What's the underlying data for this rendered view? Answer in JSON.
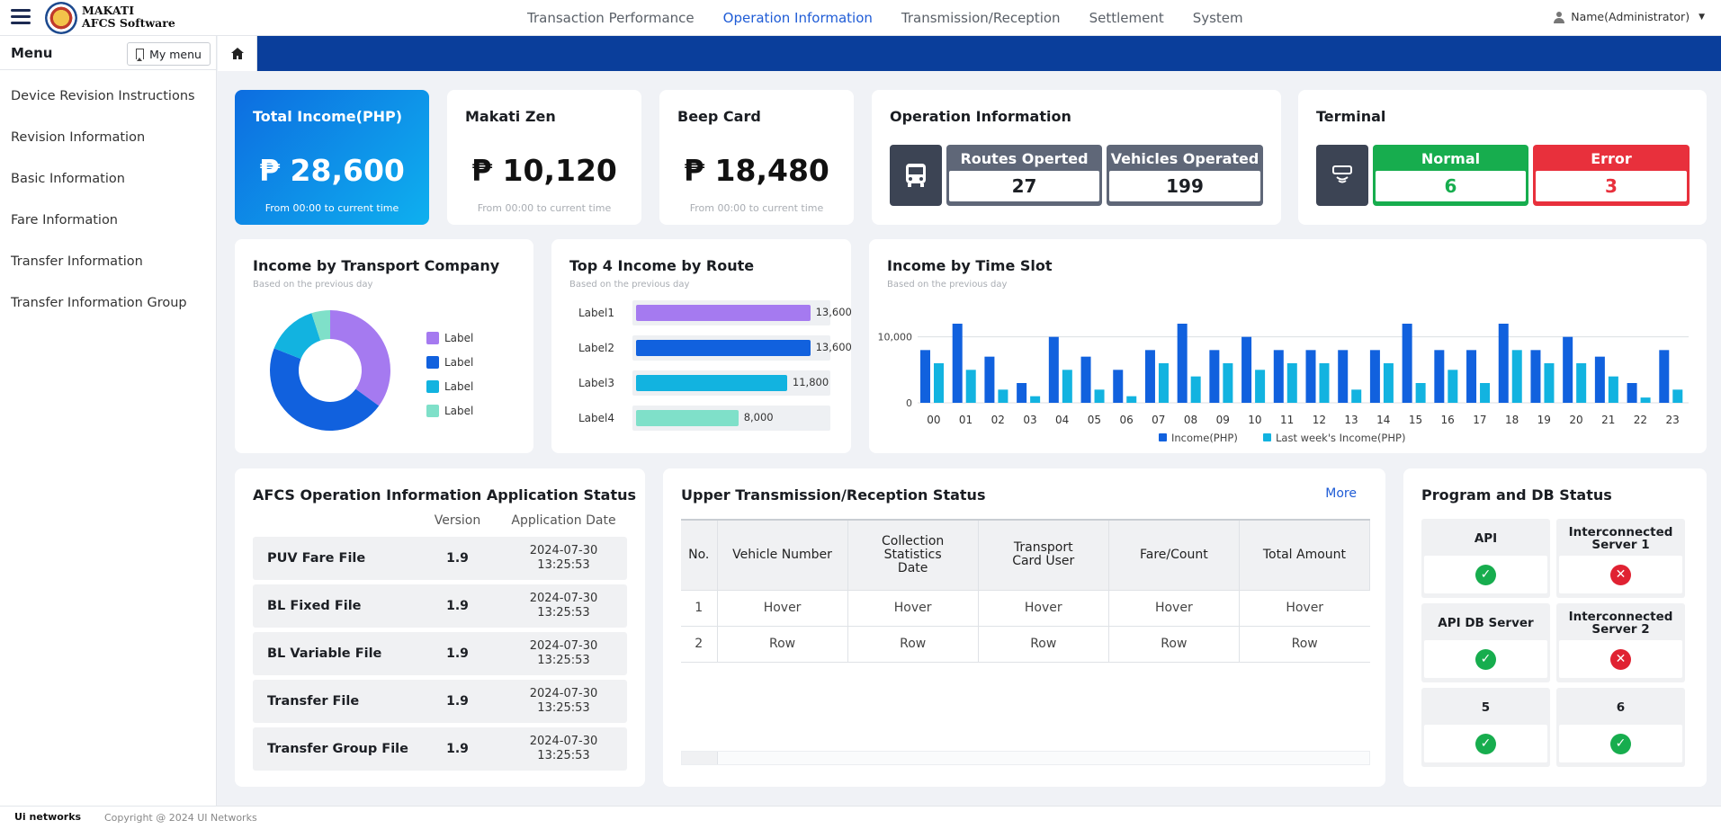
{
  "brand": {
    "line1": "MAKATI",
    "line2": "AFCS Software"
  },
  "topnav": [
    {
      "label": "Transaction Performance",
      "active": false
    },
    {
      "label": "Operation Information",
      "active": true
    },
    {
      "label": "Transmission/Reception",
      "active": false
    },
    {
      "label": "Settlement",
      "active": false
    },
    {
      "label": "System",
      "active": false
    }
  ],
  "user": {
    "name": "Name(Administrator)"
  },
  "sidebar": {
    "title": "Menu",
    "my_menu": "My menu",
    "items": [
      "Device Revision Instructions",
      "Revision Information",
      "Basic Information",
      "Fare Information",
      "Transfer Information",
      "Transfer Information Group"
    ]
  },
  "kpis": [
    {
      "title": "Total Income(PHP)",
      "value": "₱ 28,600",
      "note": "From 00:00 to current time"
    },
    {
      "title": "Makati Zen",
      "value": "₱ 10,120",
      "note": "From 00:00 to current time"
    },
    {
      "title": "Beep Card",
      "value": "₱ 18,480",
      "note": "From 00:00 to current time"
    }
  ],
  "operation": {
    "title": "Operation Information",
    "routes_label": "Routes Operted",
    "routes_value": "27",
    "vehicles_label": "Vehicles Operated",
    "vehicles_value": "199"
  },
  "terminal": {
    "title": "Terminal",
    "normal_label": "Normal",
    "normal_value": "6",
    "error_label": "Error",
    "error_value": "3"
  },
  "colors": {
    "accent": "#1f5cd6",
    "nav_bar": "#0a3e9b",
    "normal": "#17ad4e",
    "error": "#e8303c",
    "icon_box": "#3c4454",
    "stat_gray": "#5f6778"
  },
  "chart_data": [
    {
      "type": "pie",
      "title": "Income by Transport Company",
      "subtitle": "Based on the previous day",
      "labels": [
        "Label",
        "Label",
        "Label",
        "Label"
      ],
      "values": [
        35,
        46,
        14,
        5
      ],
      "colors": [
        "#a57af0",
        "#1161de",
        "#12b3e0",
        "#7fe0c9"
      ],
      "donut": true
    },
    {
      "type": "bar",
      "orientation": "horizontal",
      "title": "Top 4 Income by Route",
      "subtitle": "Based on the previous day",
      "categories": [
        "Label1",
        "Label2",
        "Label3",
        "Label4"
      ],
      "values": [
        13600,
        13600,
        11800,
        8000
      ],
      "value_labels": [
        "13,600",
        "13,600",
        "11,800",
        "8,000"
      ],
      "colors": [
        "#a57af0",
        "#1161de",
        "#12b3e0",
        "#7fe0c9"
      ]
    },
    {
      "type": "bar",
      "title": "Income by Time Slot",
      "subtitle": "Based on the previous day",
      "categories": [
        "00",
        "01",
        "02",
        "03",
        "04",
        "05",
        "06",
        "07",
        "08",
        "09",
        "10",
        "11",
        "12",
        "13",
        "14",
        "15",
        "16",
        "17",
        "18",
        "19",
        "20",
        "21",
        "22",
        "23"
      ],
      "ylim": [
        0,
        12000
      ],
      "ytick_labels": [
        "0",
        "10,000"
      ],
      "yticks": [
        0,
        10000
      ],
      "series": [
        {
          "name": "Income(PHP)",
          "color": "#1161de",
          "values": [
            8000,
            12000,
            7000,
            3000,
            10000,
            7000,
            5000,
            8000,
            12000,
            8000,
            10000,
            8000,
            8000,
            8000,
            8000,
            12000,
            8000,
            8000,
            12000,
            8000,
            10000,
            7000,
            3000,
            8000
          ]
        },
        {
          "name": "Last week's Income(PHP)",
          "color": "#12b3e0",
          "values": [
            6000,
            5000,
            2000,
            1000,
            5000,
            2000,
            1000,
            6000,
            4000,
            6000,
            5000,
            6000,
            6000,
            2000,
            6000,
            3000,
            5000,
            3000,
            8000,
            6000,
            6000,
            4000,
            800,
            2000
          ]
        }
      ],
      "legend": "bottom"
    }
  ],
  "app_status": {
    "title": "AFCS Operation Information Application Status",
    "col_version": "Version",
    "col_date": "Application Date",
    "rows": [
      {
        "name": "PUV Fare File",
        "version": "1.9",
        "date": "2024-07-30",
        "time": "13:25:53"
      },
      {
        "name": "BL Fixed File",
        "version": "1.9",
        "date": "2024-07-30",
        "time": "13:25:53"
      },
      {
        "name": "BL Variable File",
        "version": "1.9",
        "date": "2024-07-30",
        "time": "13:25:53"
      },
      {
        "name": "Transfer File",
        "version": "1.9",
        "date": "2024-07-30",
        "time": "13:25:53"
      },
      {
        "name": "Transfer Group File",
        "version": "1.9",
        "date": "2024-07-30",
        "time": "13:25:53"
      }
    ]
  },
  "upper": {
    "title": "Upper Transmission/Reception Status",
    "more": "More",
    "headers": [
      "No.",
      "Vehicle Number",
      "Collection Statistics Date",
      "Transport Card User",
      "Fare/Count",
      "Total Amount"
    ],
    "rows": [
      [
        "1",
        "Hover",
        "Hover",
        "Hover",
        "Hover",
        "Hover"
      ],
      [
        "2",
        "Row",
        "Row",
        "Row",
        "Row",
        "Row"
      ]
    ]
  },
  "program": {
    "title": "Program and DB Status",
    "items": [
      {
        "label": "API",
        "ok": true
      },
      {
        "label": "Interconnected Server 1",
        "ok": false
      },
      {
        "label": "API DB Server",
        "ok": true
      },
      {
        "label": "Interconnected Server 2",
        "ok": false
      },
      {
        "label": "5",
        "ok": true
      },
      {
        "label": "6",
        "ok": true
      }
    ]
  },
  "footer": {
    "logo": "Ui networks",
    "copyright": "Copyright @ 2024 UI Networks"
  }
}
